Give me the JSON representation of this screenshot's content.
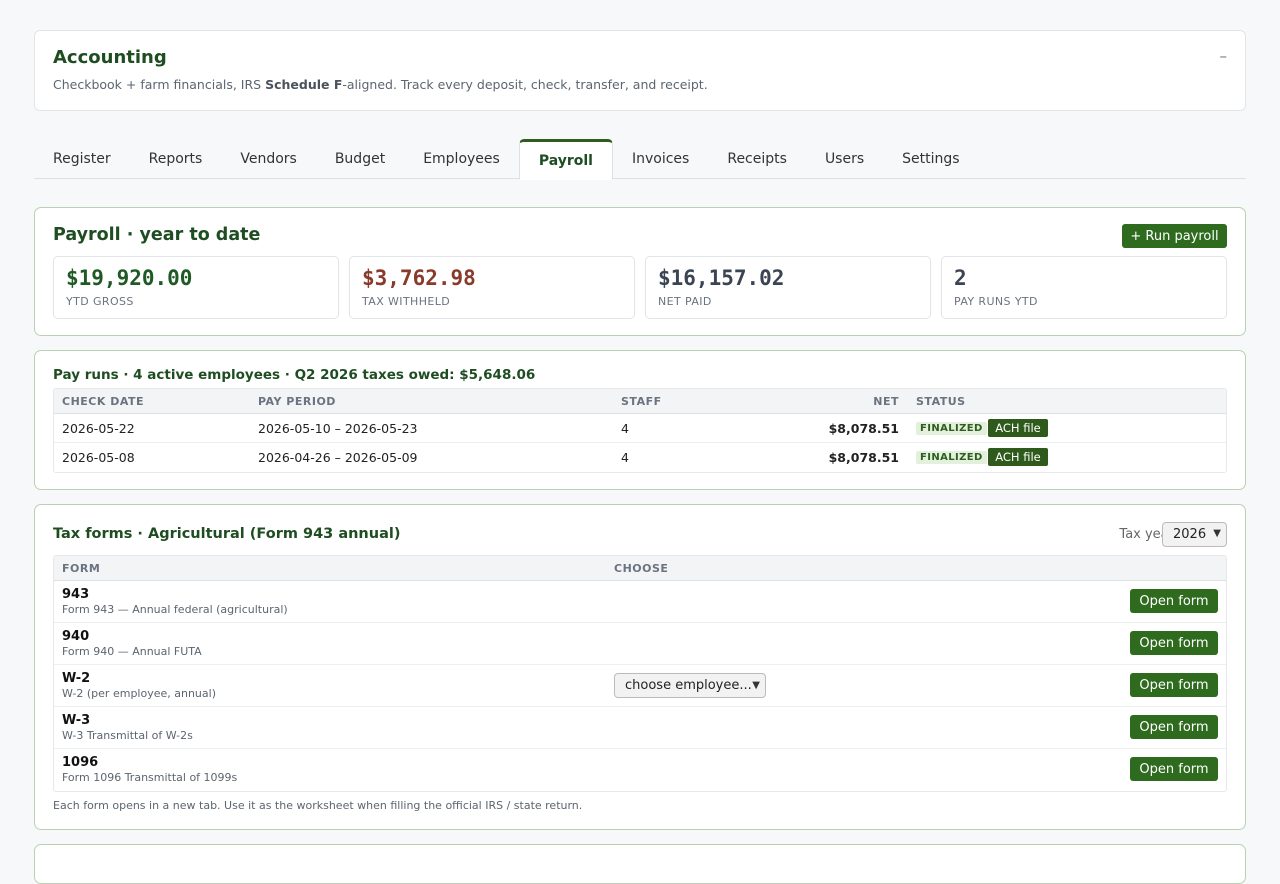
{
  "header": {
    "title": "Accounting",
    "desc_pre": "Checkbook + farm financials, IRS ",
    "desc_bold": "Schedule F",
    "desc_post": "-aligned. Track every deposit, check, transfer, and receipt.",
    "collapse": "–"
  },
  "tabs": [
    "Register",
    "Reports",
    "Vendors",
    "Budget",
    "Employees",
    "Payroll",
    "Invoices",
    "Receipts",
    "Users",
    "Settings"
  ],
  "active_tab": "Payroll",
  "payroll": {
    "title": "Payroll · year to date",
    "run_button": "+ Run payroll",
    "stats": [
      {
        "value": "$19,920.00",
        "label": "YTD GROSS",
        "color": "#1f5a24"
      },
      {
        "value": "$3,762.98",
        "label": "TAX WITHHELD",
        "color": "#8a3a2a"
      },
      {
        "value": "$16,157.02",
        "label": "NET PAID",
        "color": "#3a4452"
      },
      {
        "value": "2",
        "label": "PAY RUNS YTD",
        "color": "#3a4452"
      }
    ]
  },
  "payruns": {
    "title": "Pay runs · 4 active employees · Q2 2026 taxes owed: $5,648.06",
    "headers": {
      "check_date": "CHECK DATE",
      "pay_period": "PAY PERIOD",
      "staff": "STAFF",
      "net": "NET",
      "status": "STATUS"
    },
    "rows": [
      {
        "check_date": "2026-05-22",
        "pay_period": "2026-05-10 – 2026-05-23",
        "staff": "4",
        "net": "$8,078.51",
        "status": "FINALIZED",
        "action": "ACH file"
      },
      {
        "check_date": "2026-05-08",
        "pay_period": "2026-04-26 – 2026-05-09",
        "staff": "4",
        "net": "$8,078.51",
        "status": "FINALIZED",
        "action": "ACH file"
      }
    ]
  },
  "taxforms": {
    "title": "Tax forms · Agricultural (Form 943 annual)",
    "tax_year_label": "Tax year",
    "tax_year": "2026",
    "headers": {
      "form": "FORM",
      "choose": "CHOOSE"
    },
    "rows": [
      {
        "code": "943",
        "desc": "Form 943 — Annual federal (agricultural)",
        "choose": "",
        "button": "Open form"
      },
      {
        "code": "940",
        "desc": "Form 940 — Annual FUTA",
        "choose": "",
        "button": "Open form"
      },
      {
        "code": "W-2",
        "desc": "W-2 (per employee, annual)",
        "choose": "choose employee...",
        "button": "Open form"
      },
      {
        "code": "W-3",
        "desc": "W-3 Transmittal of W-2s",
        "choose": "",
        "button": "Open form"
      },
      {
        "code": "1096",
        "desc": "Form 1096 Transmittal of 1099s",
        "choose": "",
        "button": "Open form"
      }
    ],
    "footnote": "Each form opens in a new tab. Use it as the worksheet when filling the official IRS / state return."
  }
}
